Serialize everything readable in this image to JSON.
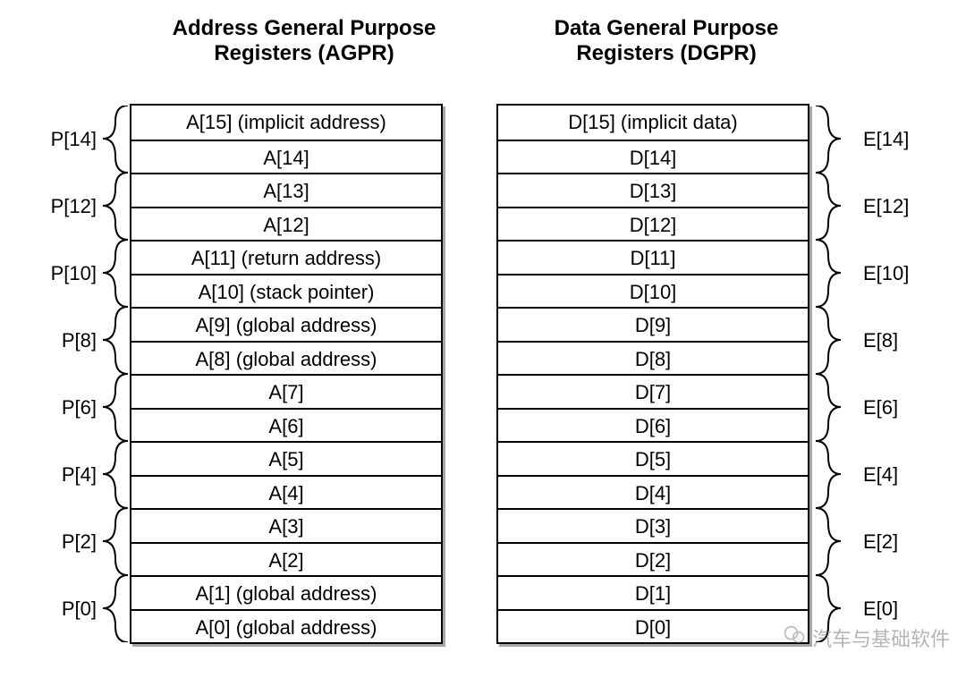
{
  "titles": {
    "left": "Address General Purpose Registers (AGPR)",
    "right": "Data General Purpose Registers (DGPR)"
  },
  "agpr": [
    "A[15] (implicit address)",
    "A[14]",
    "A[13]",
    "A[12]",
    "A[11] (return address)",
    "A[10] (stack pointer)",
    "A[9] (global address)",
    "A[8] (global address)",
    "A[7]",
    "A[6]",
    "A[5]",
    "A[4]",
    "A[3]",
    "A[2]",
    "A[1] (global address)",
    "A[0] (global address)"
  ],
  "dgpr": [
    "D[15] (implicit data)",
    "D[14]",
    "D[13]",
    "D[12]",
    "D[11]",
    "D[10]",
    "D[9]",
    "D[8]",
    "D[7]",
    "D[6]",
    "D[5]",
    "D[4]",
    "D[3]",
    "D[2]",
    "D[1]",
    "D[0]"
  ],
  "p_labels": [
    "P[14]",
    "P[12]",
    "P[10]",
    "P[8]",
    "P[6]",
    "P[4]",
    "P[2]",
    "P[0]"
  ],
  "e_labels": [
    "E[14]",
    "E[12]",
    "E[10]",
    "E[8]",
    "E[6]",
    "E[4]",
    "E[2]",
    "E[0]"
  ],
  "watermark": "汽车与基础软件"
}
